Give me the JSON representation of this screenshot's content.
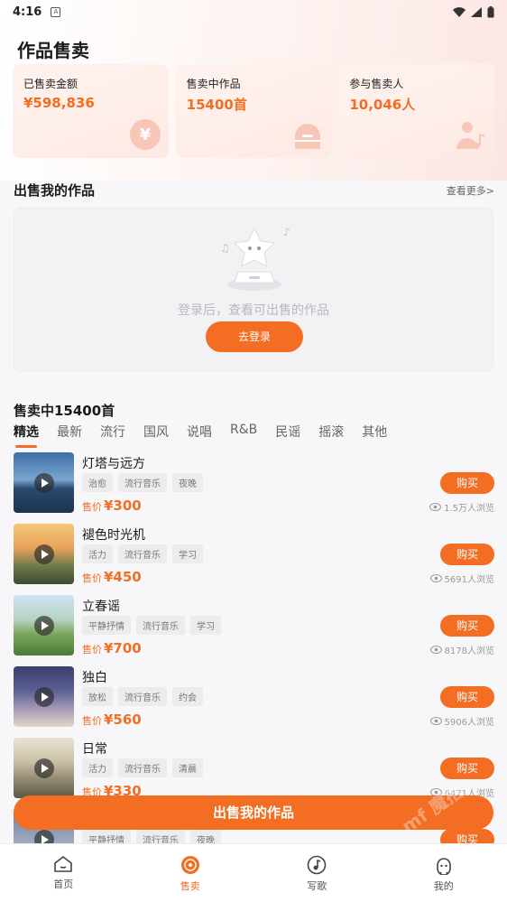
{
  "status_bar": {
    "time": "4:16",
    "notification_icon": "A"
  },
  "page_title": "作品售卖",
  "stats": [
    {
      "label": "已售卖金额",
      "value": "¥598,836",
      "icon": "yen-icon"
    },
    {
      "label": "售卖中作品",
      "value": "15400首",
      "icon": "record-player-icon"
    },
    {
      "label": "参与售卖人",
      "value": "10,046人",
      "icon": "person-music-icon"
    }
  ],
  "my_works": {
    "title": "出售我的作品",
    "more": "查看更多>",
    "empty_text": "登录后，查看可出售的作品",
    "login_button": "去登录"
  },
  "sale_count": "售卖中15400首",
  "tabs": [
    "精选",
    "最新",
    "流行",
    "国风",
    "说唱",
    "R&B",
    "民谣",
    "摇滚",
    "其他"
  ],
  "active_tab": "精选",
  "songs": [
    {
      "title": "灯塔与远方",
      "tags": [
        "治愈",
        "流行音乐",
        "夜晚"
      ],
      "price_label": "售价",
      "price": "¥300",
      "buy": "购买",
      "views": "1.5万人浏览"
    },
    {
      "title": "褪色时光机",
      "tags": [
        "活力",
        "流行音乐",
        "学习"
      ],
      "price_label": "售价",
      "price": "¥450",
      "buy": "购买",
      "views": "5691人浏览"
    },
    {
      "title": "立春谣",
      "tags": [
        "平静抒情",
        "流行音乐",
        "学习"
      ],
      "price_label": "售价",
      "price": "¥700",
      "buy": "购买",
      "views": "8178人浏览"
    },
    {
      "title": "独白",
      "tags": [
        "放松",
        "流行音乐",
        "约会"
      ],
      "price_label": "售价",
      "price": "¥560",
      "buy": "购买",
      "views": "5906人浏览"
    },
    {
      "title": "日常",
      "tags": [
        "活力",
        "流行音乐",
        "清晨"
      ],
      "price_label": "售价",
      "price": "¥330",
      "buy": "购买",
      "views": "6471人浏览"
    },
    {
      "title": "",
      "tags": [
        "平静抒情",
        "流行音乐",
        "夜晚"
      ],
      "price_label": "",
      "price": "",
      "buy": "购买",
      "views": ""
    }
  ],
  "cta_button": "出售我的作品",
  "watermark": "mf 魔搭",
  "nav": [
    {
      "label": "首页",
      "icon": "home-icon"
    },
    {
      "label": "售卖",
      "icon": "vinyl-icon"
    },
    {
      "label": "写歌",
      "icon": "music-note-icon"
    },
    {
      "label": "我的",
      "icon": "profile-icon"
    }
  ],
  "colors": {
    "accent": "#f36d23",
    "background": "#f7f7f9"
  }
}
